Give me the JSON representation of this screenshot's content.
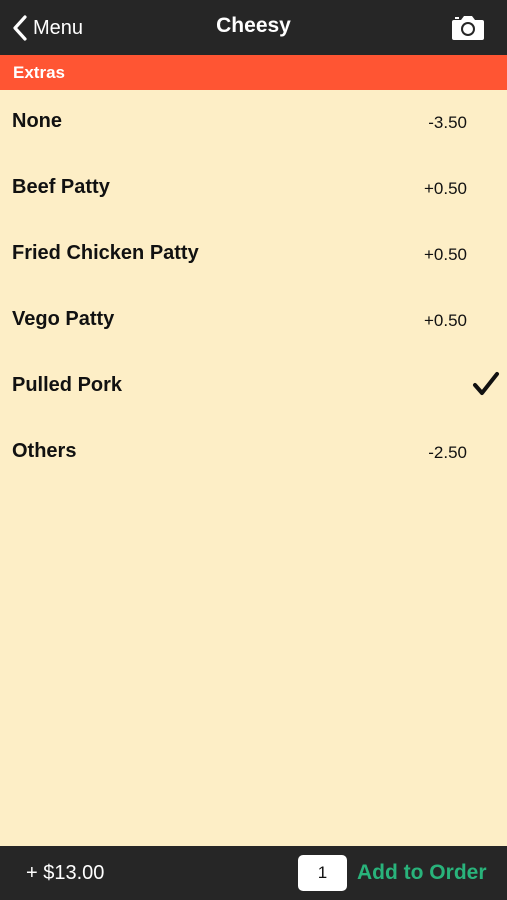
{
  "navbar": {
    "back_label": "Menu",
    "title": "Cheesy",
    "back_icon": "chevron-left-icon",
    "camera_icon": "camera-icon"
  },
  "section": {
    "title": "Extras"
  },
  "options": [
    {
      "name": "None",
      "price": "-3.50",
      "selected": false
    },
    {
      "name": "Beef Patty",
      "price": "+0.50",
      "selected": false
    },
    {
      "name": "Fried Chicken Patty",
      "price": "+0.50",
      "selected": false
    },
    {
      "name": "Vego Patty",
      "price": "+0.50",
      "selected": false
    },
    {
      "name": "Pulled Pork",
      "price": "",
      "selected": true
    },
    {
      "name": "Others",
      "price": "-2.50",
      "selected": false
    }
  ],
  "footer": {
    "total": "+ $13.00",
    "quantity": "1",
    "add_label": "Add to Order"
  },
  "colors": {
    "background": "#fdeec6",
    "bar": "#262626",
    "section_header": "#ff5533",
    "accent": "#29b37b"
  }
}
